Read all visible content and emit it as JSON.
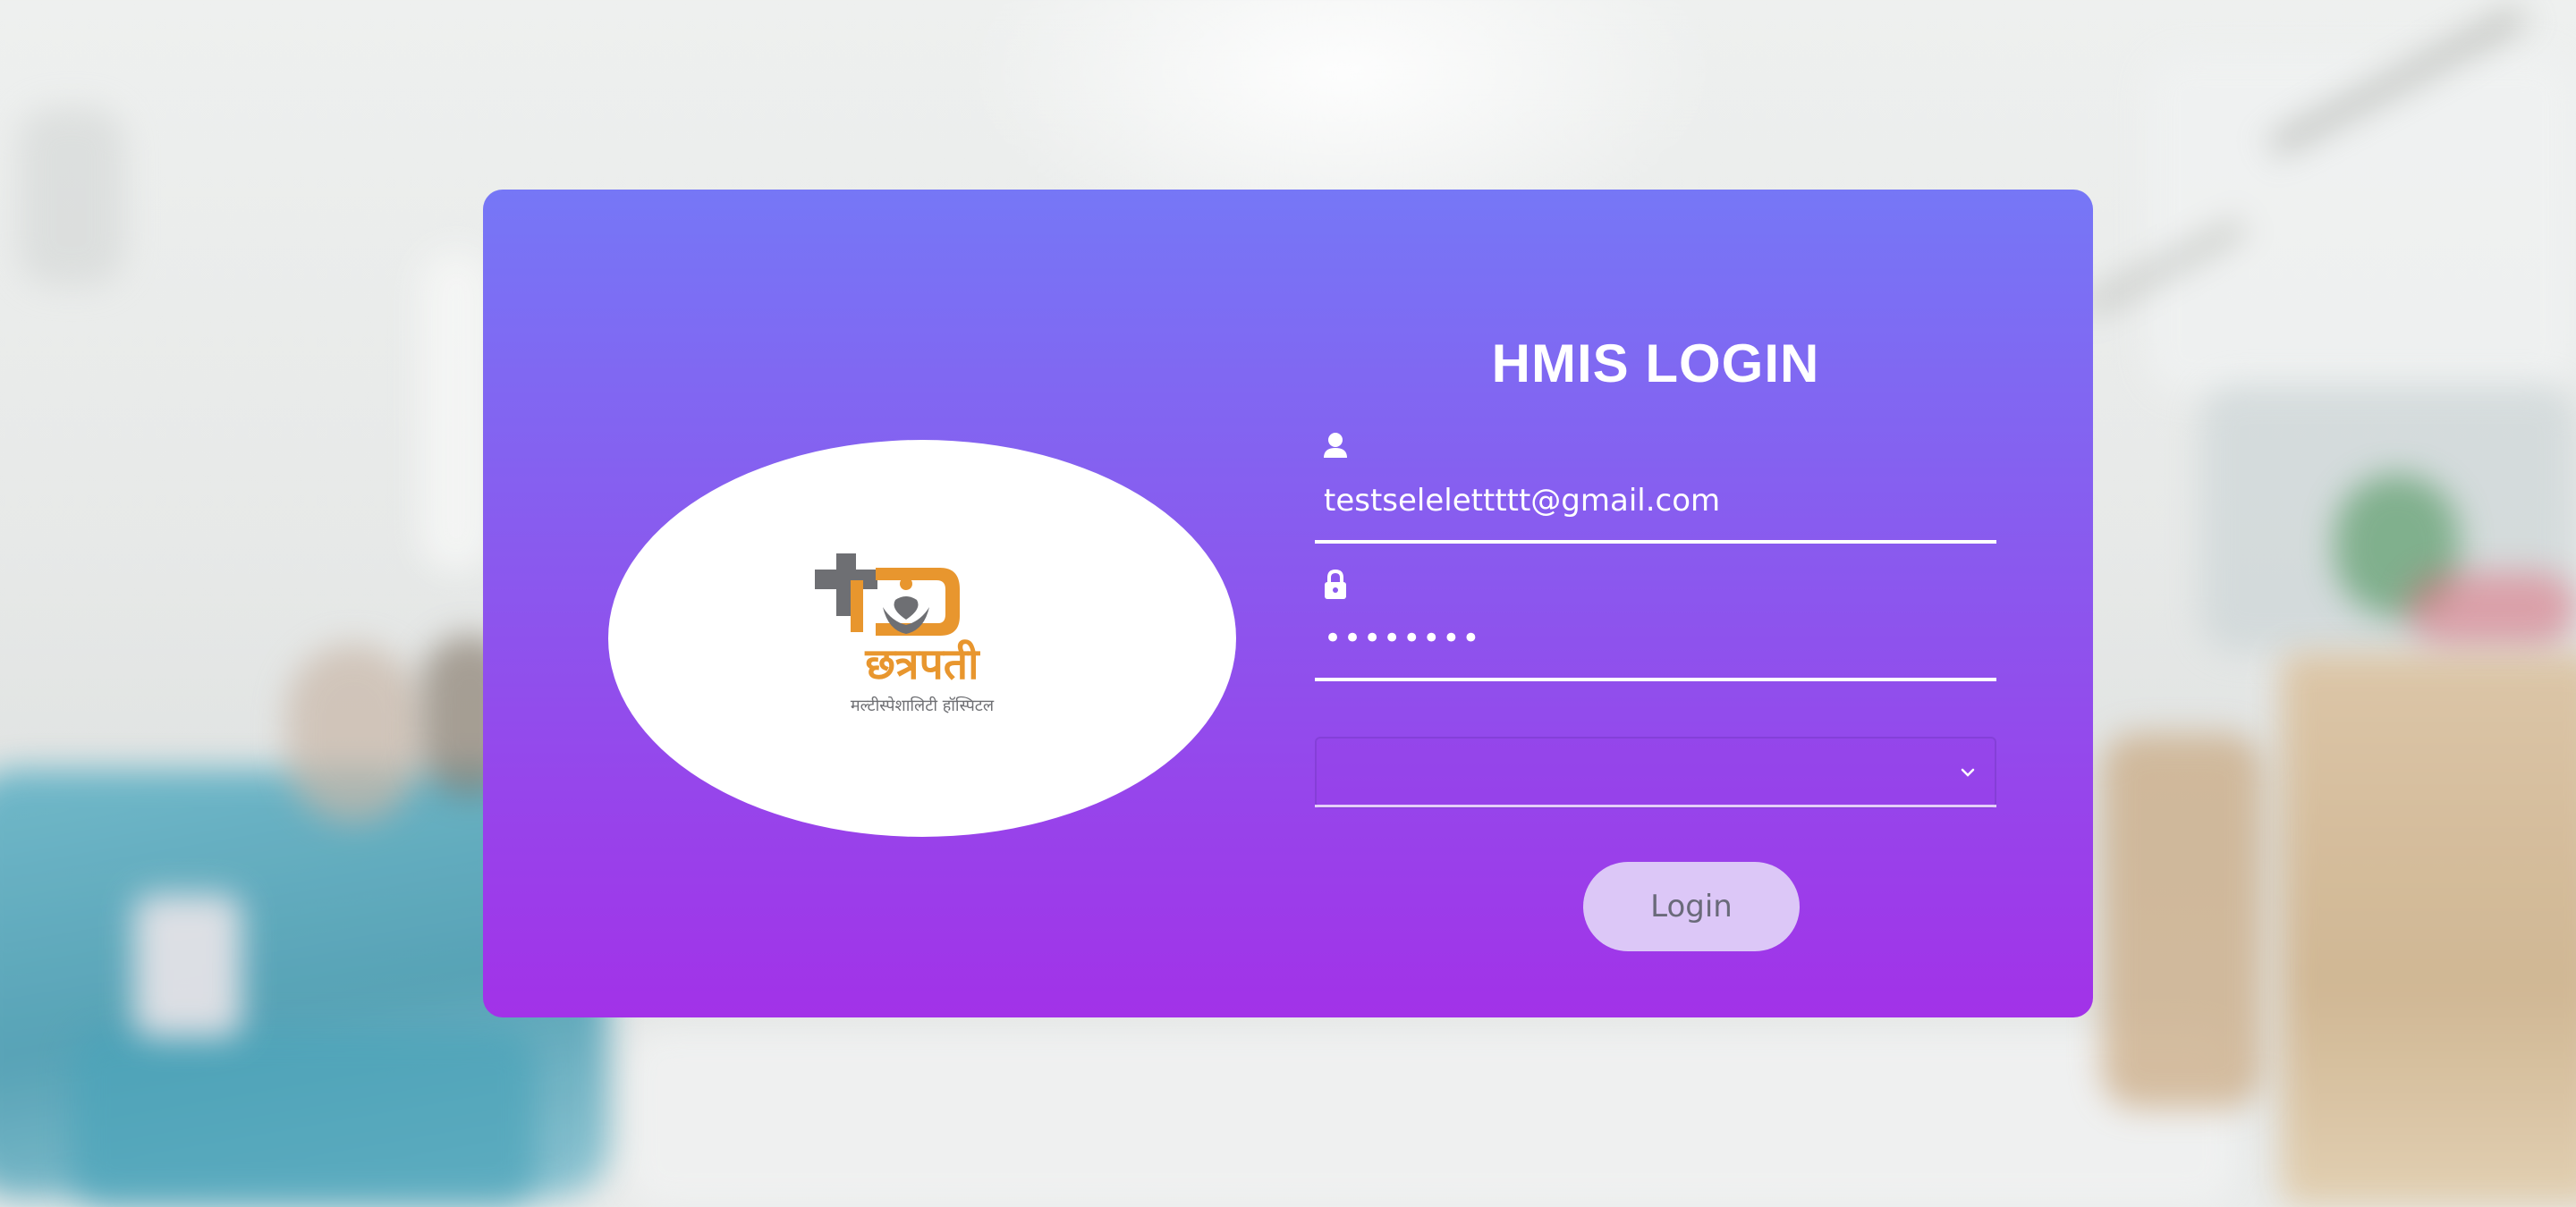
{
  "login": {
    "title": "HMIS LOGIN",
    "username_value": "testselelettttt@gmail.com",
    "password_value": "••••••••",
    "select_value": "",
    "login_label": "Login"
  },
  "logo": {
    "brand_name": "छत्रपती",
    "tagline": "मल्टीस्पेशालिटी हॉस्पिटल"
  },
  "icons": {
    "user": "user-icon",
    "lock": "lock-icon",
    "dropdown": "chevron-down-icon"
  },
  "colors": {
    "card_top": "#7677f6",
    "card_bottom": "#a232e8",
    "button_bg": "#dcc7f7",
    "logo_orange": "#e8962e",
    "logo_gray": "#6e6f73"
  }
}
